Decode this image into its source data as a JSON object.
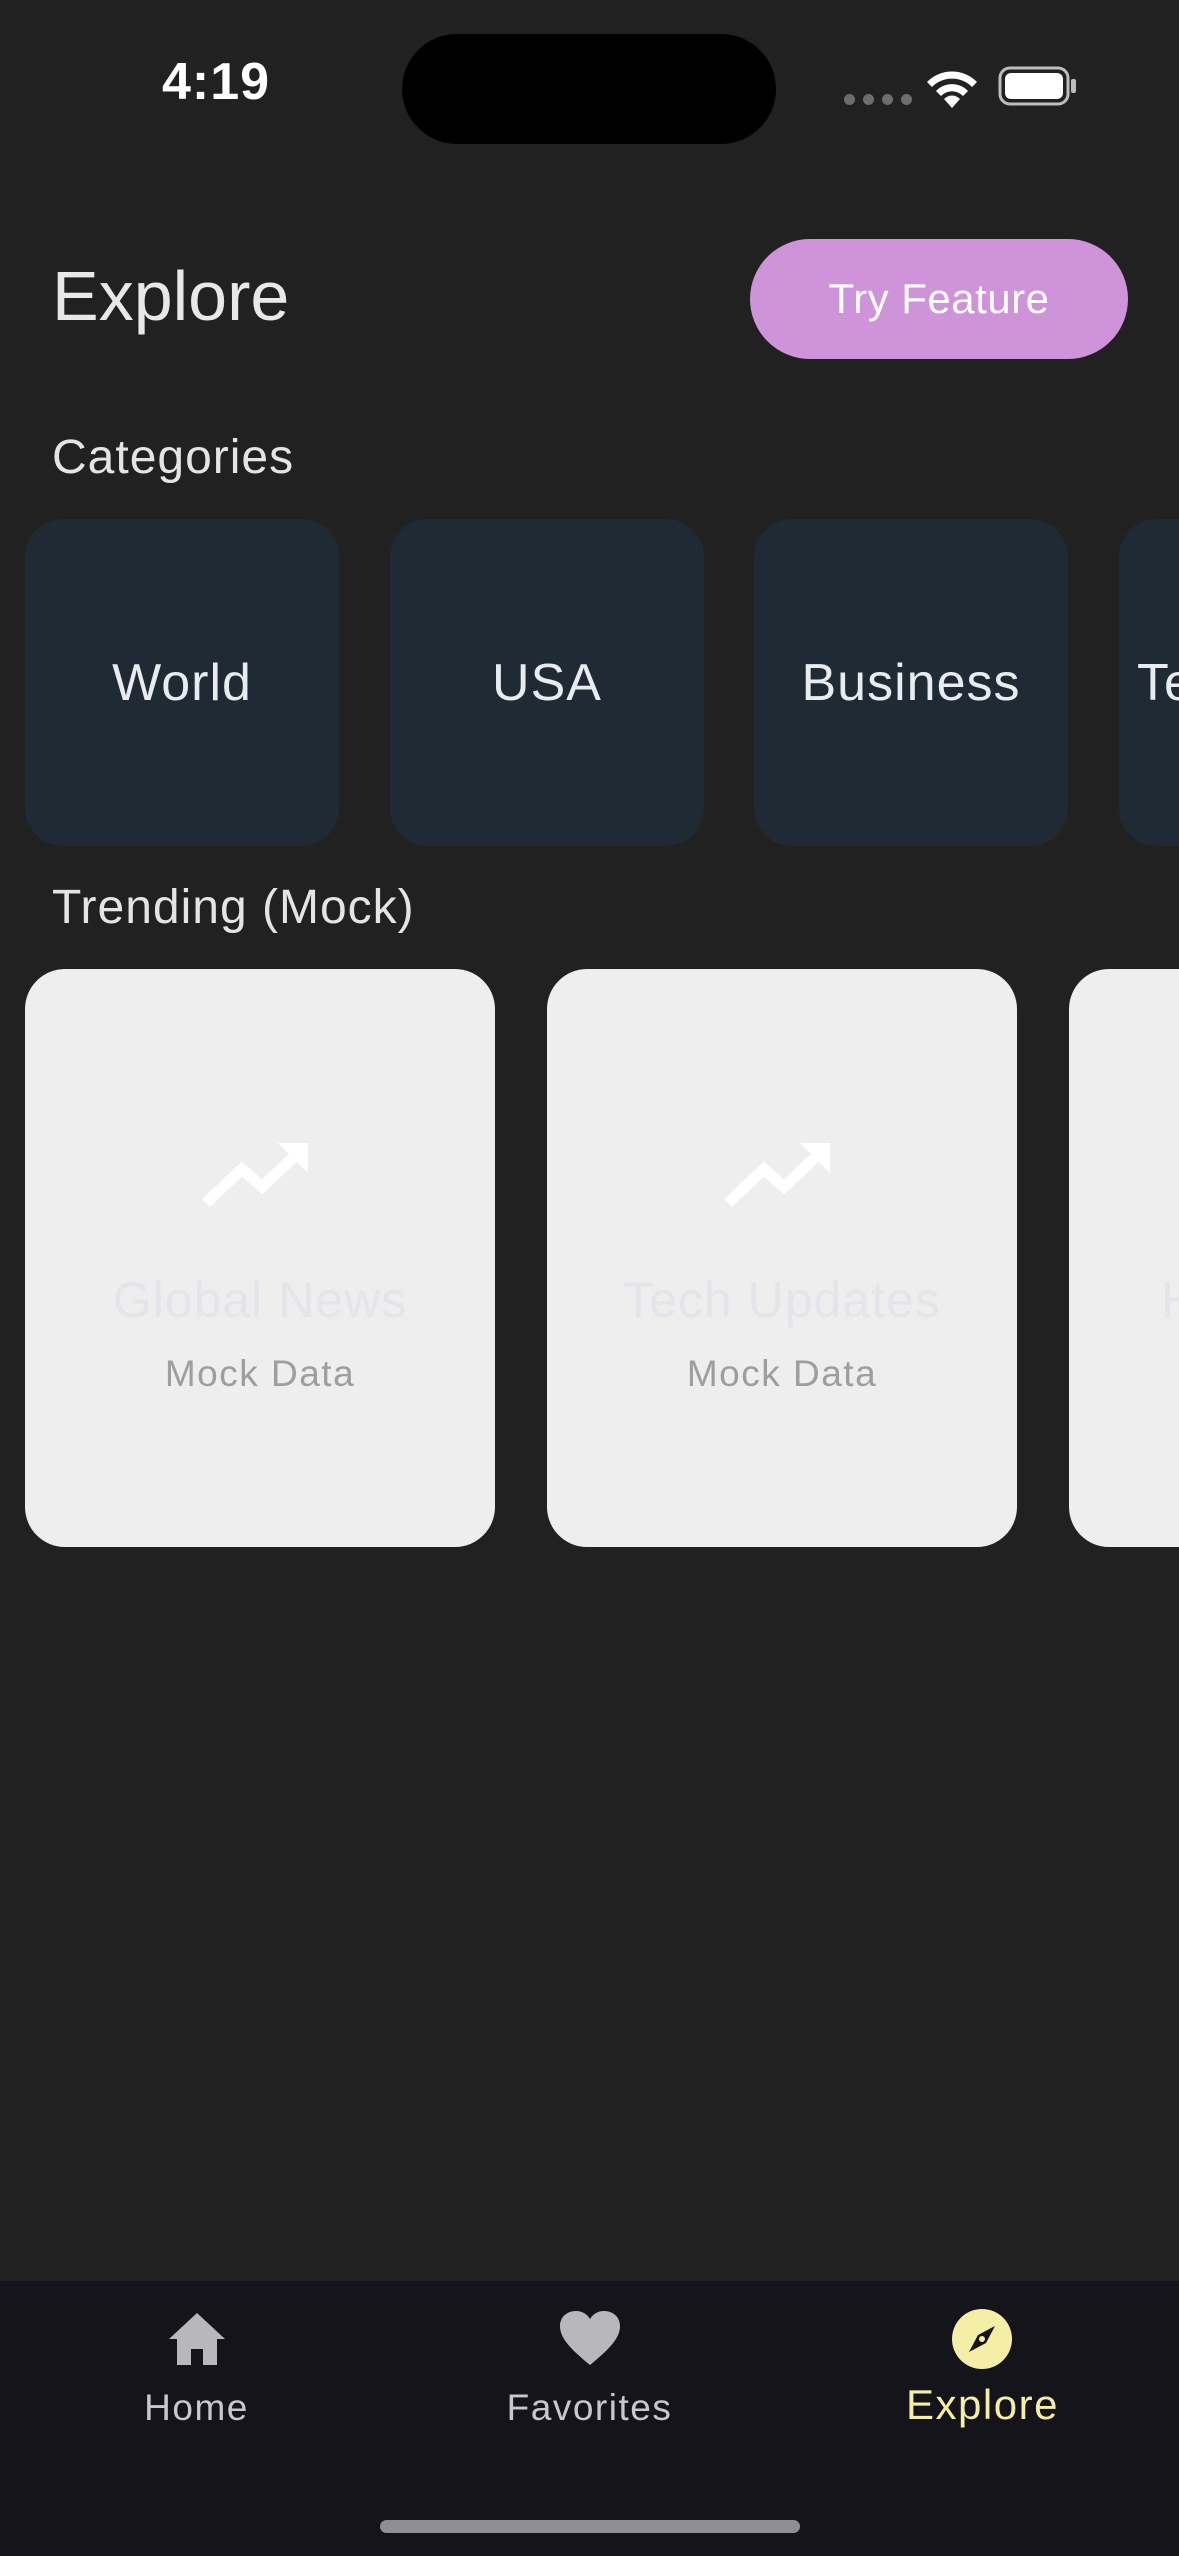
{
  "status_bar": {
    "time": "4:19"
  },
  "header": {
    "title": "Explore",
    "action_label": "Try Feature"
  },
  "categories": {
    "heading": "Categories",
    "items": [
      {
        "label": "World"
      },
      {
        "label": "USA"
      },
      {
        "label": "Business"
      },
      {
        "label": "Te"
      }
    ]
  },
  "trending": {
    "heading": "Trending (Mock)",
    "items": [
      {
        "title": "Global News",
        "subtitle": "Mock Data",
        "icon": "trending-up-icon"
      },
      {
        "title": "Tech Updates",
        "subtitle": "Mock Data",
        "icon": "trending-up-icon"
      },
      {
        "title": "H",
        "subtitle": "",
        "icon": ""
      }
    ]
  },
  "bottom_nav": {
    "items": [
      {
        "label": "Home",
        "icon": "home-icon",
        "active": false
      },
      {
        "label": "Favorites",
        "icon": "heart-icon",
        "active": false
      },
      {
        "label": "Explore",
        "icon": "compass-icon",
        "active": true
      }
    ]
  },
  "colors": {
    "background": "#212121",
    "accent_button": "#ce93d8",
    "category_card": "#1f2a35",
    "trend_card": "#eeeeee",
    "nav_active": "#f5eea6",
    "nav_bar": "#15141a"
  }
}
